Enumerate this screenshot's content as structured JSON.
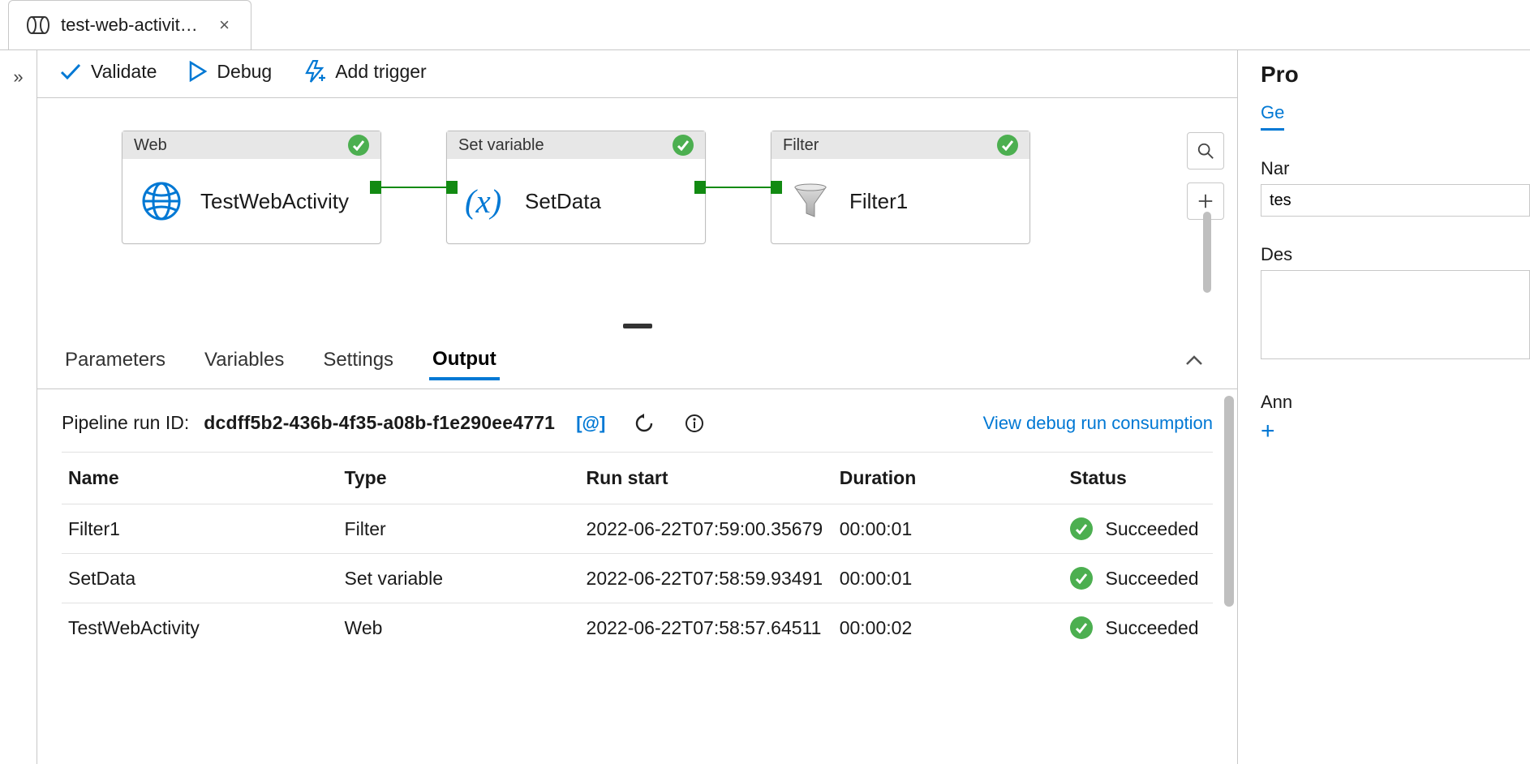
{
  "tab": {
    "title": "test-web-activity-p...",
    "icon": "pipeline-icon"
  },
  "toolbar": {
    "validate": "Validate",
    "debug": "Debug",
    "add_trigger": "Add trigger"
  },
  "canvas": {
    "activities": [
      {
        "type_label": "Web",
        "name": "TestWebActivity",
        "icon": "globe-icon",
        "status": "success"
      },
      {
        "type_label": "Set variable",
        "name": "SetData",
        "icon": "variable-icon",
        "status": "success"
      },
      {
        "type_label": "Filter",
        "name": "Filter1",
        "icon": "funnel-icon",
        "status": "success"
      }
    ]
  },
  "panel_tabs": {
    "parameters": "Parameters",
    "variables": "Variables",
    "settings": "Settings",
    "output": "Output",
    "active": "output"
  },
  "output": {
    "run_id_label": "Pipeline run ID:",
    "run_id": "dcdff5b2-436b-4f35-a08b-f1e290ee4771",
    "debug_link": "View debug run consumption",
    "columns": {
      "name": "Name",
      "type": "Type",
      "run_start": "Run start",
      "duration": "Duration",
      "status": "Status"
    },
    "rows": [
      {
        "name": "Filter1",
        "type": "Filter",
        "run_start": "2022-06-22T07:59:00.35679",
        "duration": "00:00:01",
        "status": "Succeeded"
      },
      {
        "name": "SetData",
        "type": "Set variable",
        "run_start": "2022-06-22T07:58:59.93491",
        "duration": "00:00:01",
        "status": "Succeeded"
      },
      {
        "name": "TestWebActivity",
        "type": "Web",
        "run_start": "2022-06-22T07:58:57.64511",
        "duration": "00:00:02",
        "status": "Succeeded"
      }
    ]
  },
  "right": {
    "panel_title": "Pro",
    "general_tab": "Ge",
    "name_label": "Nar",
    "name_value": "tes",
    "description_label": "Des",
    "description_value": "",
    "annotations_label": "Ann"
  }
}
